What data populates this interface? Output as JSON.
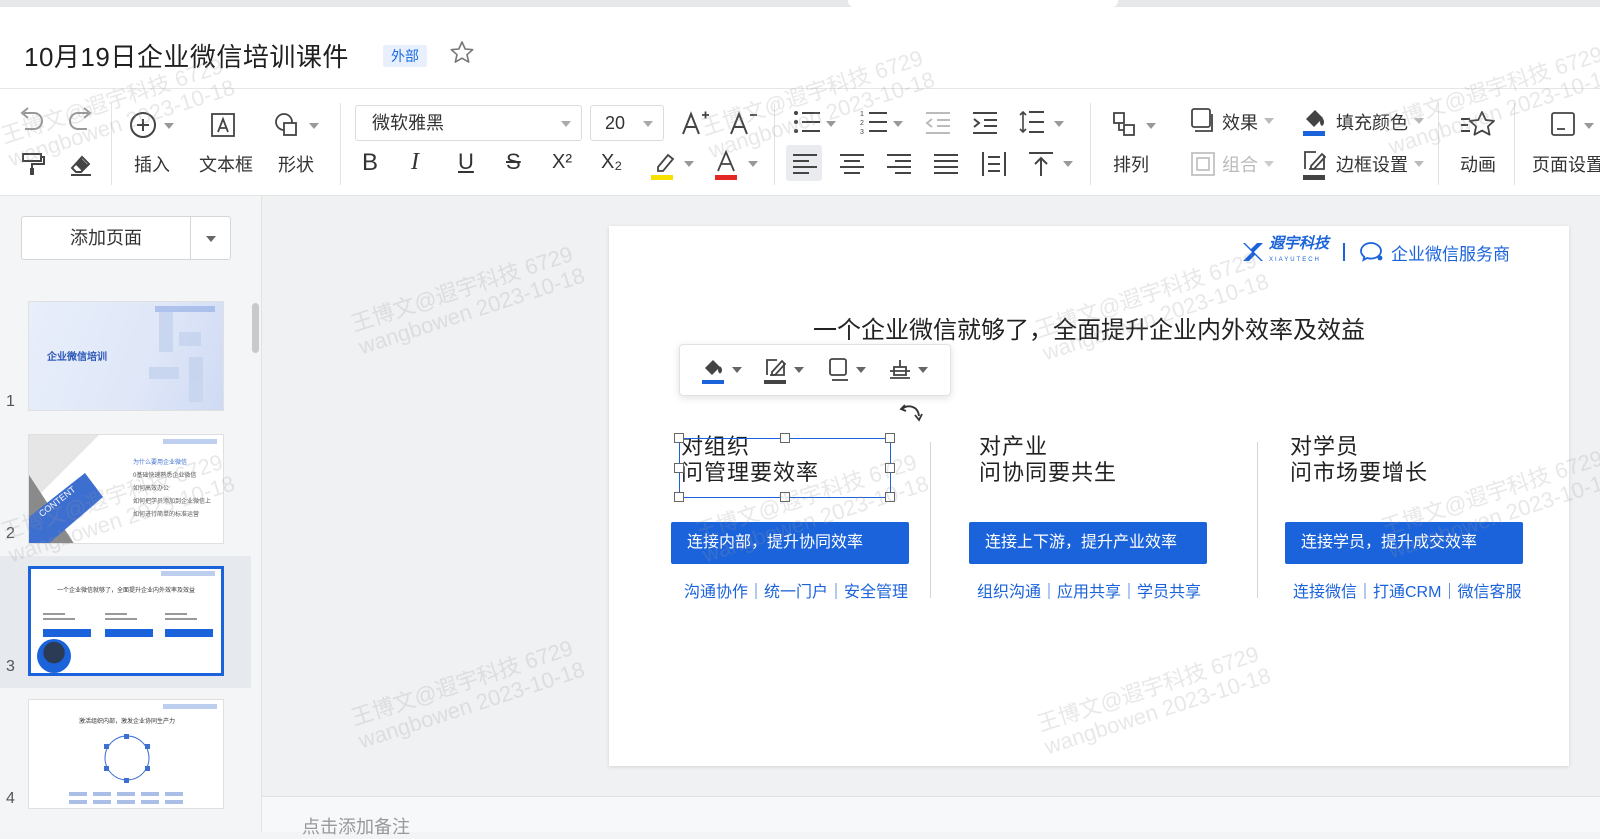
{
  "doc": {
    "title": "10月19日企业微信培训课件",
    "badge": "外部"
  },
  "toolbar": {
    "insert": "插入",
    "textbox": "文本框",
    "shape": "形状",
    "font": "微软雅黑",
    "font_size": "20",
    "superscript": "X²",
    "subscript": "X₂",
    "effect": "效果",
    "group": "组合",
    "fill_color": "填充颜色",
    "border_setting": "边框设置",
    "arrange": "排列",
    "animation": "动画",
    "page_setting": "页面设置",
    "highlight_color": "#f5e000",
    "font_color": "#e32626"
  },
  "sidebar": {
    "add_page": "添加页面",
    "thumbs": [
      {
        "num": "1",
        "title": "企业微信培训"
      },
      {
        "num": "2",
        "label": "CONTENT",
        "items": [
          "为什么要用企业微信",
          "0基础快速熟悉企业微信",
          "如何高效办公",
          "如何把学员添加到企业微信上",
          "如何进行简单的标准运营"
        ]
      },
      {
        "num": "3",
        "headline": "一个企业微信就够了，全面提升企业内外效率及效益"
      },
      {
        "num": "4",
        "headline": "激活组织内部，激发企业协同生产力"
      }
    ]
  },
  "slide": {
    "brand": "遐宇科技",
    "brand_en": "XIAYUTECH",
    "partner": "企业微信服务商",
    "headline": "一个企业微信就够了，全面提升企业内外效率及效益",
    "columns": [
      {
        "line1": "对组织",
        "line2": "问管理要效率",
        "button": "连接内部，提升协同效率",
        "sub": "沟通协作｜统一门户｜安全管理"
      },
      {
        "line1": "对产业",
        "line2": "问协同要共生",
        "button": "连接上下游，提升产业效率",
        "sub": "组织沟通｜应用共享｜学员共享"
      },
      {
        "line1": "对学员",
        "line2": "问市场要增长",
        "button": "连接学员，提升成交效率",
        "sub": "连接微信｜打通CRM｜微信客服"
      }
    ]
  },
  "notes": {
    "placeholder": "点击添加备注"
  },
  "watermark": {
    "line1": "王博文@遐宇科技 6729",
    "line2": "wangbowen 2023-10-18"
  },
  "colors": {
    "accent": "#1b63db"
  }
}
